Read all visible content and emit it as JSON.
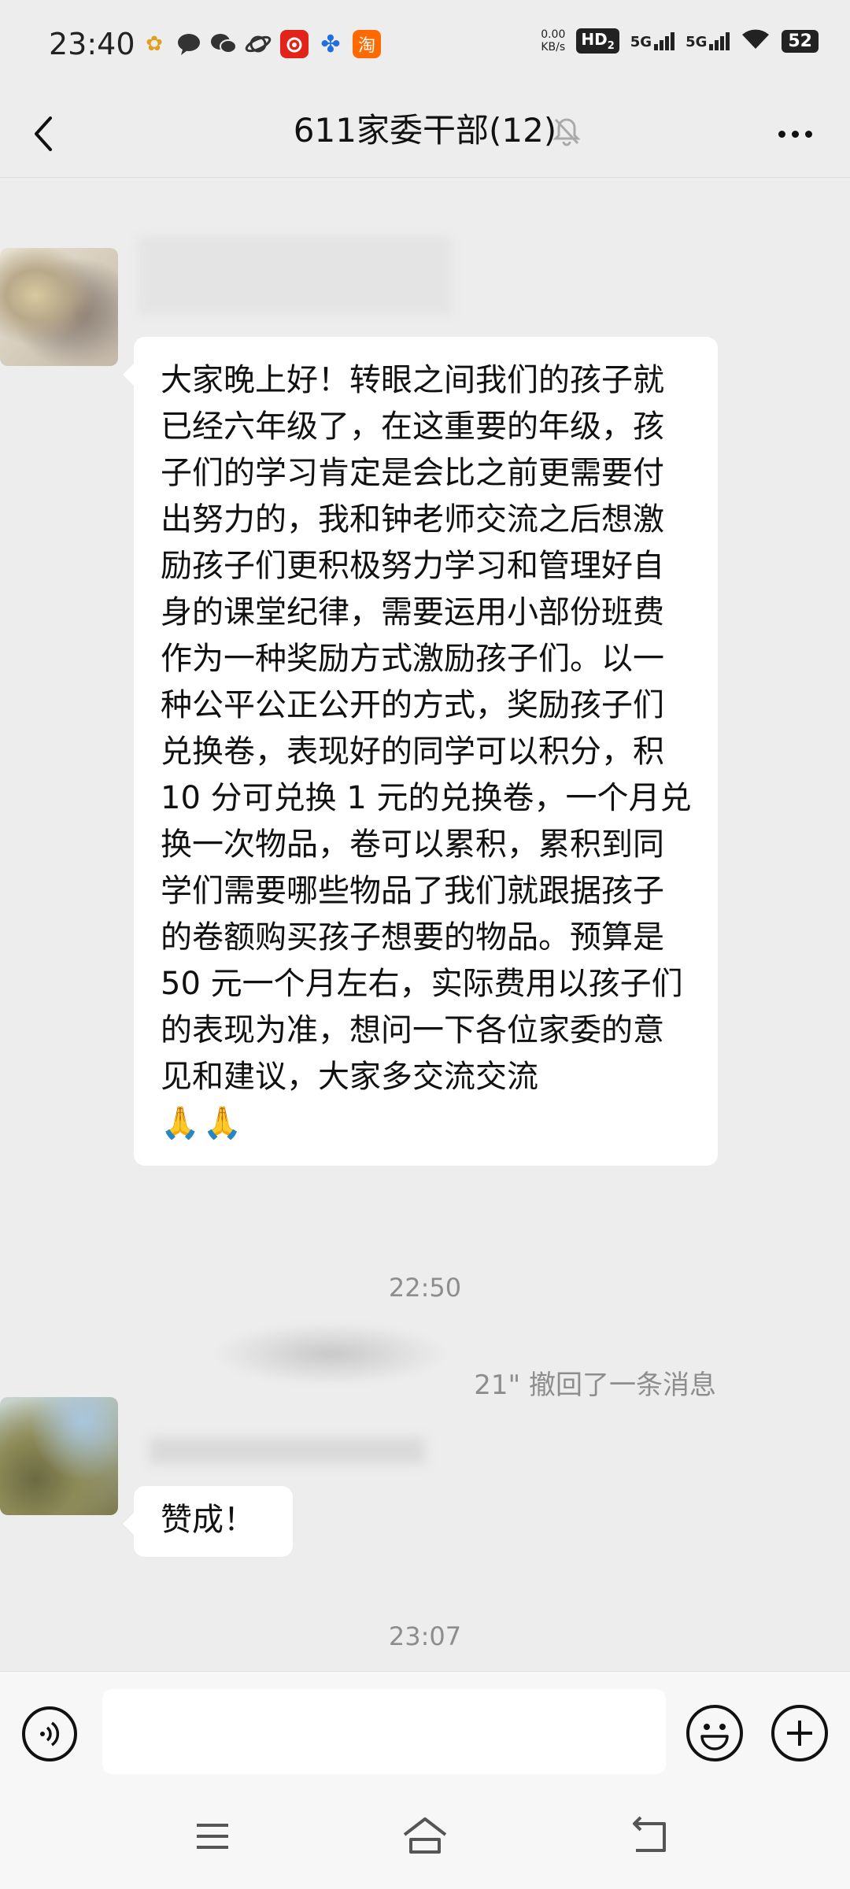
{
  "status": {
    "time": "23:40",
    "speed_value": "0.00",
    "speed_unit": "KB/s",
    "hd": "HD",
    "hd_sub": "2",
    "net1": "5G",
    "net2": "5G",
    "battery": "52",
    "noti_icons": [
      "taobao-like-app-icon",
      "message-icon",
      "wechat-icon",
      "planet-icon",
      "netease-music-icon",
      "flower-app-icon",
      "taobao-icon"
    ],
    "noti_taobao_label": "淘"
  },
  "header": {
    "title": "611家委干部(12)"
  },
  "messages": {
    "first_text": "大家晚上好！转眼之间我们的孩子就已经六年级了，在这重要的年级，孩子们的学习肯定是会比之前更需要付出努力的，我和钟老师交流之后想激励孩子们更积极努力学习和管理好自身的课堂纪律，需要运用小部份班费作为一种奖励方式激励孩子们。以一种公平公正公开的方式，奖励孩子们兑换卷，表现好的同学可以积分，积 10 分可兑换 1 元的兑换卷，一个月兑换一次物品，卷可以累积，累积到同学们需要哪些物品了我们就跟据孩子的卷额购买孩子想要的物品。预算是 50 元一个月左右，实际费用以孩子们的表现为准，想问一下各位家委的意见和建议，大家多交流交流",
    "first_emoji": "🙏🙏",
    "timestamp_1": "22:50",
    "recall_text": "21\" 撤回了一条消息",
    "second_text": "赞成！",
    "timestamp_2": "23:07"
  },
  "input": {
    "placeholder": ""
  }
}
